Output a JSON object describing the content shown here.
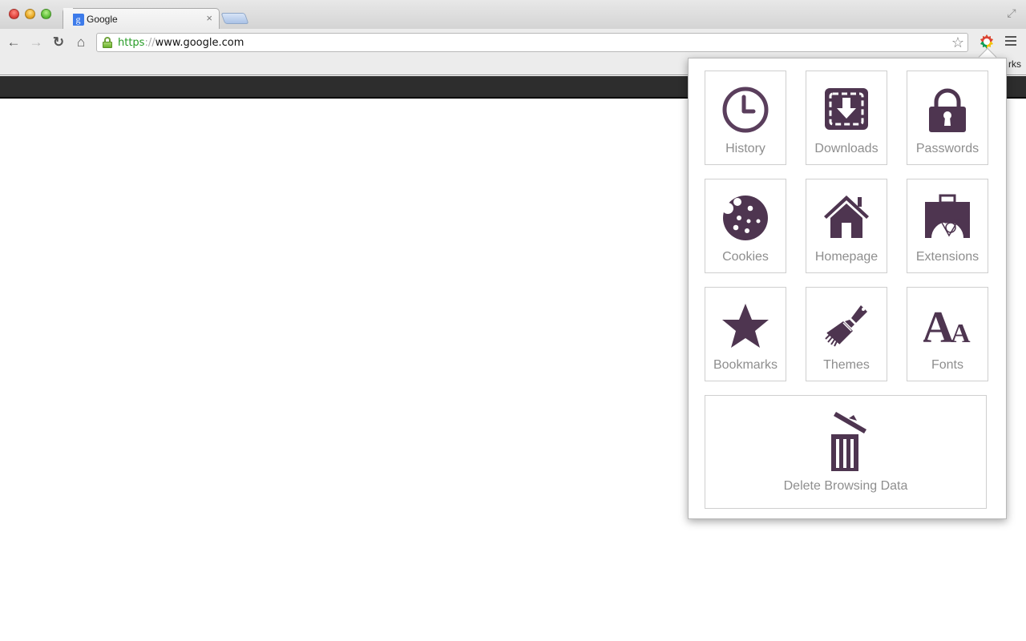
{
  "window": {
    "traffic_lights": [
      "close",
      "minimize",
      "maximize"
    ]
  },
  "tabs": [
    {
      "title": "Google",
      "favicon": "g",
      "active": true,
      "close_glyph": "×"
    }
  ],
  "toolbar": {
    "back_glyph": "←",
    "forward_glyph": "→",
    "reload_glyph": "↻",
    "home_glyph": "⌂",
    "url": {
      "scheme": "https",
      "separator": "://",
      "host": "www.google.com"
    },
    "star_glyph": "☆",
    "fullscreen_glyph": "⤢"
  },
  "bookmarks_bar": {
    "partial_label": "rks"
  },
  "popup": {
    "accent_color": "#4e3550",
    "tiles": [
      {
        "label": "History",
        "icon": "clock-icon"
      },
      {
        "label": "Downloads",
        "icon": "download-icon"
      },
      {
        "label": "Passwords",
        "icon": "padlock-icon"
      },
      {
        "label": "Cookies",
        "icon": "cookie-icon"
      },
      {
        "label": "Homepage",
        "icon": "house-icon"
      },
      {
        "label": "Extensions",
        "icon": "extension-bag-icon"
      },
      {
        "label": "Bookmarks",
        "icon": "star-icon"
      },
      {
        "label": "Themes",
        "icon": "paintbrush-icon"
      },
      {
        "label": "Fonts",
        "icon": "fonts-icon"
      }
    ],
    "delete_tile": {
      "label": "Delete Browsing Data",
      "icon": "trash-icon"
    }
  }
}
